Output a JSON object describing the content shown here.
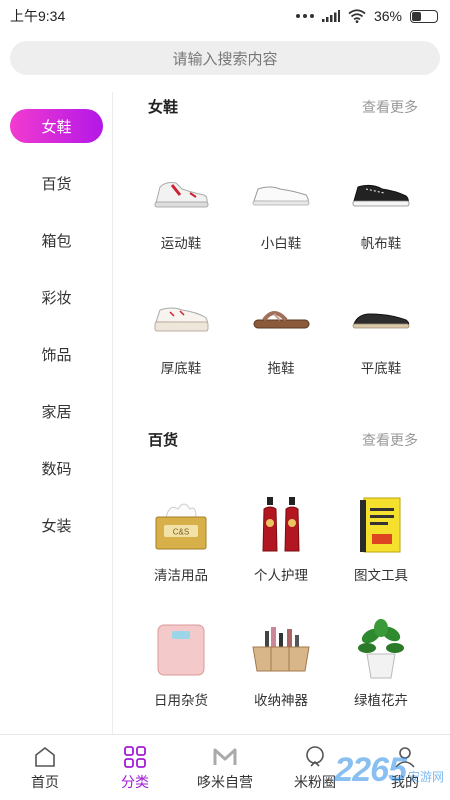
{
  "status_bar": {
    "time": "上午9:34",
    "battery": "36%",
    "battery_level": 0.36
  },
  "search": {
    "placeholder": "请输入搜索内容"
  },
  "sidebar": {
    "items": [
      {
        "label": "女鞋",
        "active": true
      },
      {
        "label": "百货"
      },
      {
        "label": "箱包"
      },
      {
        "label": "彩妆"
      },
      {
        "label": "饰品"
      },
      {
        "label": "家居"
      },
      {
        "label": "数码"
      },
      {
        "label": "女装"
      }
    ]
  },
  "sections": [
    {
      "title": "女鞋",
      "more": "查看更多",
      "items": [
        {
          "label": "运动鞋",
          "icon": "sneaker-icon"
        },
        {
          "label": "小白鞋",
          "icon": "white-shoe-icon"
        },
        {
          "label": "帆布鞋",
          "icon": "canvas-shoe-icon"
        },
        {
          "label": "厚底鞋",
          "icon": "platform-shoe-icon"
        },
        {
          "label": "拖鞋",
          "icon": "slipper-icon"
        },
        {
          "label": "平底鞋",
          "icon": "flat-shoe-icon"
        }
      ]
    },
    {
      "title": "百货",
      "more": "查看更多",
      "items": [
        {
          "label": "清洁用品",
          "icon": "tissue-box-icon"
        },
        {
          "label": "个人护理",
          "icon": "shampoo-bottles-icon"
        },
        {
          "label": "图文工具",
          "icon": "book-icon"
        },
        {
          "label": "日用杂货",
          "icon": "scale-icon"
        },
        {
          "label": "收纳神器",
          "icon": "organizer-box-icon"
        },
        {
          "label": "绿植花卉",
          "icon": "potted-plant-icon"
        }
      ]
    }
  ],
  "bottom_nav": {
    "items": [
      {
        "label": "首页",
        "icon": "home-icon"
      },
      {
        "label": "分类",
        "icon": "category-icon",
        "active": true
      },
      {
        "label": "哆米自营",
        "icon": "m-logo-icon"
      },
      {
        "label": "米粉圈",
        "icon": "community-icon"
      },
      {
        "label": "我的",
        "icon": "profile-icon"
      }
    ]
  },
  "watermark": {
    "number": "2265",
    "text": "安游网"
  },
  "colors": {
    "accent": "#b317e6",
    "accent_start": "#f23bd0",
    "nav_active": "#a21bd6"
  }
}
